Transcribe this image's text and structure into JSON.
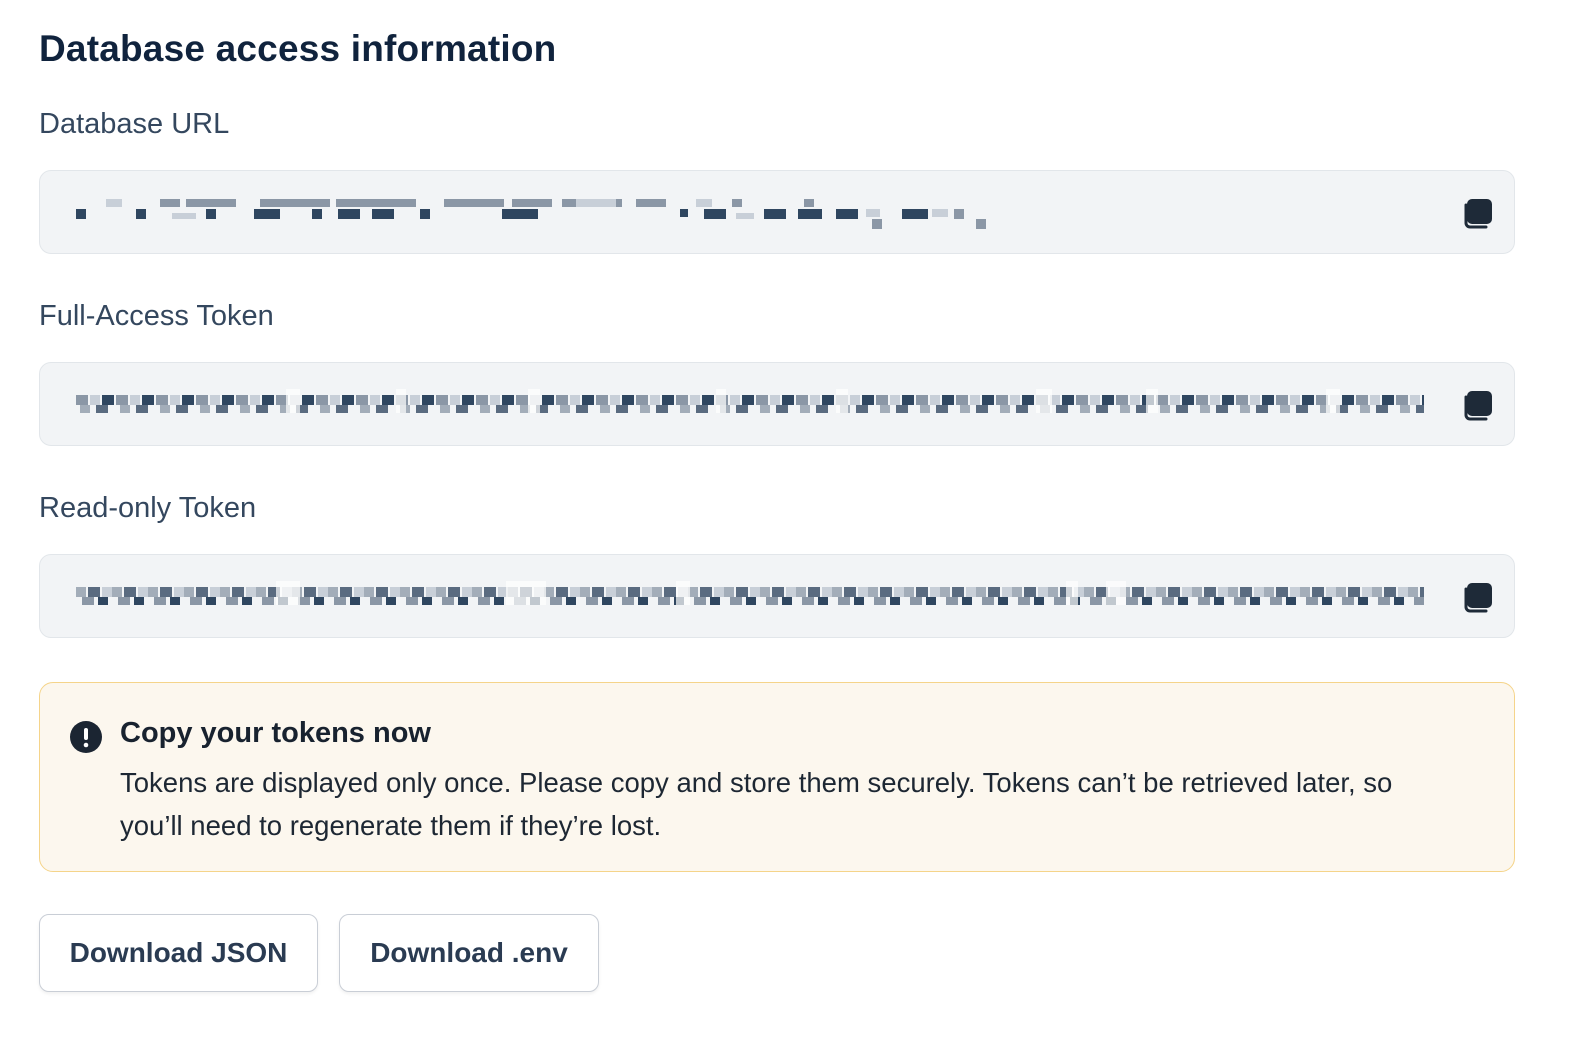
{
  "header": {
    "title": "Database access information"
  },
  "fields": [
    {
      "label": "Database URL",
      "value_redacted": true,
      "copy_icon": "copy-icon"
    },
    {
      "label": "Full-Access Token",
      "value_redacted": true,
      "copy_icon": "copy-icon"
    },
    {
      "label": "Read-only Token",
      "value_redacted": true,
      "copy_icon": "copy-icon"
    }
  ],
  "warning": {
    "icon": "exclamation-circle-icon",
    "title": "Copy your tokens now",
    "body": "Tokens are displayed only once. Please copy and store them securely. Tokens can’t be retrieved later, so you’ll need to regenerate them if they’re lost."
  },
  "actions": {
    "download_json_label": "Download JSON",
    "download_env_label": "Download .env"
  },
  "colors": {
    "field_background": "#f2f4f6",
    "warning_background": "#fcf7ee",
    "warning_border": "#f5d48a",
    "text_primary": "#10233d"
  }
}
